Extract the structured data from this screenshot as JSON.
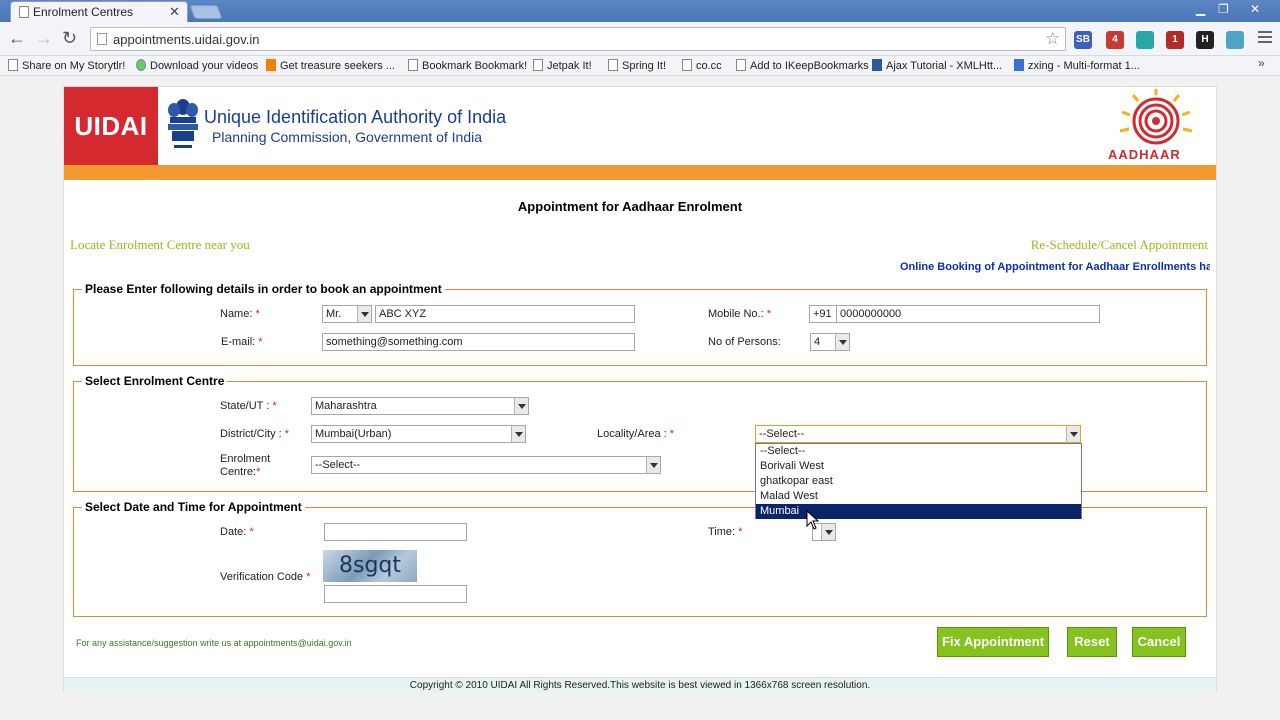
{
  "browser": {
    "tab_title": "Enrolment Centres",
    "url": "appointments.uidai.gov.in",
    "bookmarks": [
      "Share on My Storytlr!",
      "Download your videos",
      "Get treasure seekers ...",
      "Bookmark Bookmark!",
      "Jetpak It!",
      "Spring It!",
      "co.cc",
      "Add to IKeepBookmarks",
      "Ajax Tutorial - XMLHtt...",
      "zxing - Multi-format 1..."
    ],
    "extensions": [
      {
        "icon": "sb-icon",
        "text": "SB",
        "color": "#3a5fbf"
      },
      {
        "icon": "windows-badge-icon",
        "text": "4",
        "color": "#c63b2f"
      },
      {
        "icon": "teal-extension-icon",
        "text": "",
        "color": "#2aa7a8"
      },
      {
        "icon": "red-extension-icon",
        "text": "1",
        "color": "#b32a2a"
      },
      {
        "icon": "h-extension-icon",
        "text": "H",
        "color": "#222222"
      },
      {
        "icon": "heart-extension-icon",
        "text": "",
        "color": "#4fa3c4"
      }
    ]
  },
  "header": {
    "logo_text": "UIDAI",
    "org_line1": "Unique Identification Authority of India",
    "org_line2": "Planning Commission, Government of India",
    "aadhaar_text": "AADHAAR"
  },
  "page": {
    "title": "Appointment for Aadhaar Enrolment",
    "locate_link": "Locate Enrolment Centre near you",
    "reschedule_link": "Re-Schedule/Cancel Appointment",
    "marquee": "Online Booking of Appointment for Aadhaar Enrollments ha"
  },
  "details": {
    "legend": "Please Enter following details in order to book an appointment",
    "name_label": "Name:",
    "title_value": "Mr.",
    "name_value": "ABC XYZ",
    "email_label": "E-mail:",
    "email_value": "something@something.com",
    "mobile_label": "Mobile No.:",
    "mobile_prefix": "+91",
    "mobile_value": "0000000000",
    "persons_label": "No of Persons:",
    "persons_value": "4"
  },
  "centre": {
    "legend": "Select Enrolment Centre",
    "state_label": "State/UT :",
    "state_value": "Maharashtra",
    "district_label": "District/City :",
    "district_value": "Mumbai(Urban)",
    "locality_label": "Locality/Area :",
    "locality_value": "--Select--",
    "locality_options": [
      "--Select--",
      "Borivali West",
      "ghatkopar east",
      "Malad West",
      "Mumbai"
    ],
    "enrolment_label_1": "Enrolment",
    "enrolment_label_2": "Centre:",
    "enrolment_value": "--Select--"
  },
  "datetime": {
    "legend": "Select Date and Time for Appointment",
    "date_label": "Date:",
    "time_label": "Time:",
    "verification_label": "Verification Code",
    "captcha_text": "8sgqt"
  },
  "required_mark": "*",
  "assist_text": "For any assistance/suggestion write us at appointments@uidai.gov.in",
  "buttons": {
    "fix": "Fix Appointment",
    "reset": "Reset",
    "cancel": "Cancel"
  },
  "footer": "Copyright © 2010 UIDAI All Rights Reserved.This website is best viewed in 1366x768 screen resolution."
}
